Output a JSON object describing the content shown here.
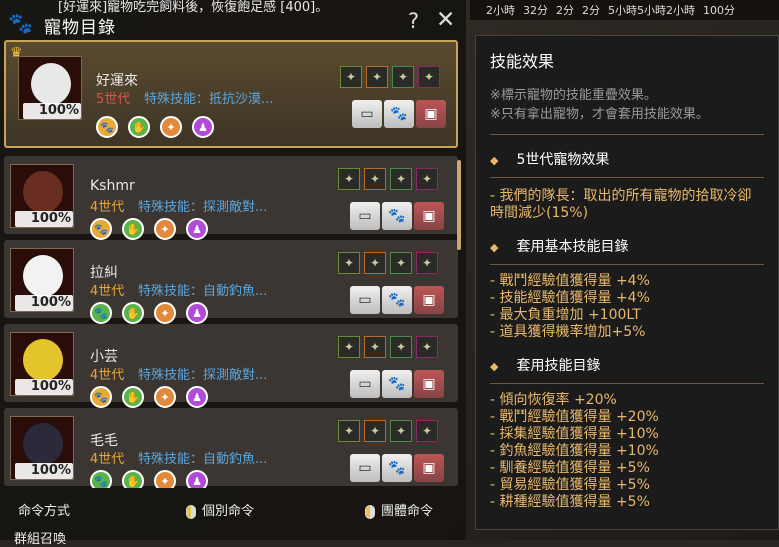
{
  "notice": "[好運來]寵物吃完飼料後，恢復飽足感 [400]。",
  "topbar": [
    "2小時",
    "32分",
    "2分",
    "2分",
    "5小時5小時2小時",
    "100分"
  ],
  "header": {
    "title": "寵物目錄",
    "help": "?",
    "close": "✕"
  },
  "pets": [
    {
      "name": "好運來",
      "gen": "5世代",
      "skill": "特殊技能：抵抗沙漠...",
      "pct": "100%",
      "gen_color": "#d9534f",
      "selected": true,
      "art": "#e8e8e8"
    },
    {
      "name": "Kshmr",
      "gen": "4世代",
      "skill": "特殊技能：探測敵對...",
      "pct": "100%",
      "gen_color": "#e6a43a",
      "selected": false,
      "art": "#6a2d22"
    },
    {
      "name": "拉糾",
      "gen": "4世代",
      "skill": "特殊技能：自動釣魚...",
      "pct": "100%",
      "gen_color": "#e6a43a",
      "selected": false,
      "art": "#f2f2f2"
    },
    {
      "name": "小芸",
      "gen": "4世代",
      "skill": "特殊技能：探測敵對...",
      "pct": "100%",
      "gen_color": "#e6a43a",
      "selected": false,
      "art": "#e3c42a"
    },
    {
      "name": "毛毛",
      "gen": "4世代",
      "skill": "特殊技能：自動釣魚...",
      "pct": "100%",
      "gen_color": "#e6a43a",
      "selected": false,
      "art": "#2a2a3a"
    }
  ],
  "footer": {
    "command_label": "命令方式",
    "individual": "個別命令",
    "group": "團體命令",
    "group_call": "群組召喚"
  },
  "tooltip": {
    "title": "技能效果",
    "notes": [
      "※標示寵物的技能重疊效果。",
      "※只有拿出寵物，才會套用技能效果。"
    ],
    "gen_section": "5世代寵物效果",
    "gen_effect": "- 我們的隊長：取出的所有寵物的拾取冷卻時間減少(15%)",
    "base_section": "套用基本技能目錄",
    "base_effects": [
      "- 戰鬥經驗值獲得量 +4%",
      "- 技能經驗值獲得量 +4%",
      "- 最大負重增加 +100LT",
      "- 道具獲得機率增加+5%"
    ],
    "skill_section": "套用技能目錄",
    "skill_effects": [
      "- 傾向恢復率 +20%",
      "- 戰鬥經驗值獲得量 +20%",
      "- 採集經驗值獲得量 +10%",
      "- 釣魚經驗值獲得量 +10%",
      "- 馴養經驗值獲得量 +5%",
      "- 貿易經驗值獲得量 +5%",
      "- 耕種經驗值獲得量 +5%"
    ]
  },
  "colors": {
    "gold": "#c9a25a",
    "skill_blue": "#5aa6e0",
    "effect": "#e8b86a"
  }
}
